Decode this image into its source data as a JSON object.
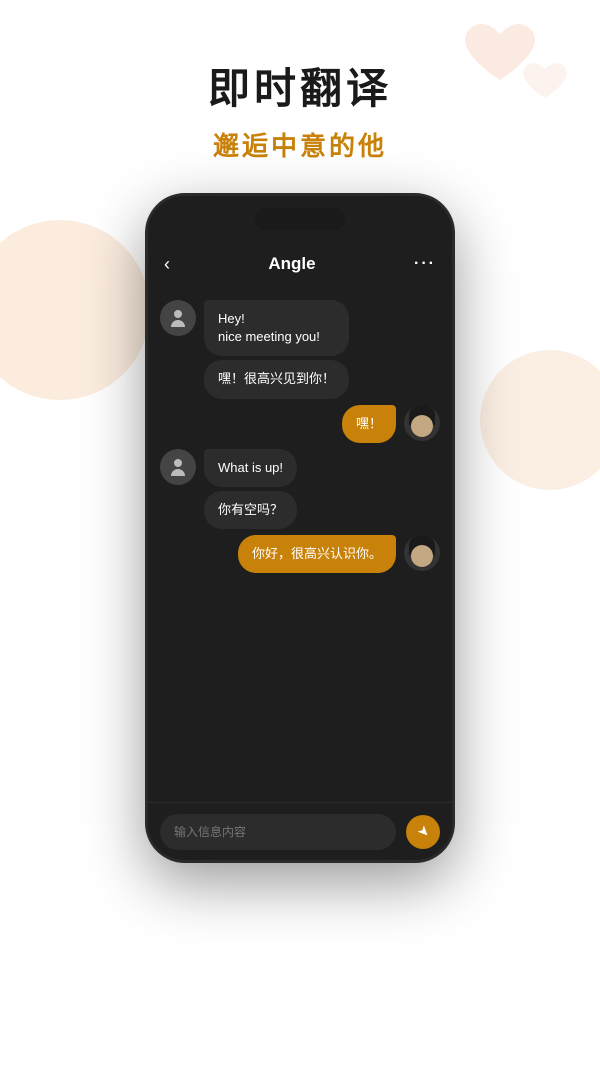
{
  "hero": {
    "title": "即时翻译",
    "subtitle": "邂逅中意的他"
  },
  "chat": {
    "header": {
      "back_label": "‹",
      "title": "Angle",
      "more_label": "···"
    },
    "messages": [
      {
        "id": "msg1",
        "type": "received",
        "text": "Hey!\nnice meeting you!",
        "has_translation": true,
        "translation": "嘿！很高兴见到你！",
        "show_avatar": true
      },
      {
        "id": "msg2",
        "type": "sent",
        "text": "嘿！",
        "has_translation": false,
        "show_avatar": true
      },
      {
        "id": "msg3",
        "type": "received",
        "text": "What is up!",
        "has_translation": true,
        "translation": "你有空吗？",
        "show_avatar": true
      },
      {
        "id": "msg4",
        "type": "sent",
        "text": "你好，很高兴认识你。",
        "has_translation": false,
        "show_avatar": true
      }
    ],
    "input": {
      "placeholder": "输入信息内容"
    }
  }
}
